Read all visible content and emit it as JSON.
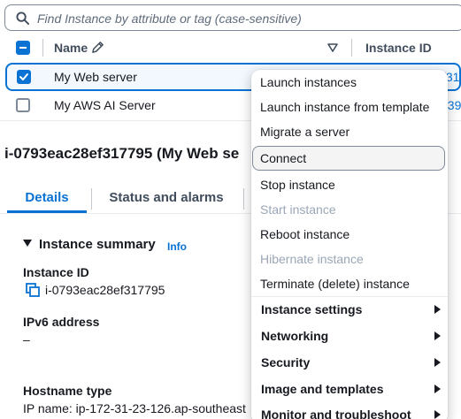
{
  "search": {
    "placeholder": "Find Instance by attribute or tag (case-sensitive)"
  },
  "table": {
    "headers": {
      "name": "Name",
      "instance_id": "Instance ID"
    },
    "rows": [
      {
        "name": "My Web server",
        "id_fragment": "f31",
        "selected": true
      },
      {
        "name": "My AWS AI Server",
        "id_fragment": "a39",
        "selected": false
      }
    ]
  },
  "details": {
    "title": "i-0793eac28ef317795 (My Web se",
    "tabs": [
      "Details",
      "Status and alarms"
    ],
    "summary": {
      "heading": "Instance summary",
      "info": "Info",
      "instance_id_label": "Instance ID",
      "instance_id_value": "i-0793eac28ef317795",
      "ipv6_label": "IPv6 address",
      "ipv6_value": "–",
      "hostname_label": "Hostname type",
      "hostname_value": "IP name: ip-172-31-23-126.ap-southeast"
    }
  },
  "menu": {
    "items": [
      {
        "label": "Launch instances"
      },
      {
        "label": "Launch instance from template"
      },
      {
        "label": "Migrate a server"
      },
      {
        "label": "Connect",
        "highlighted": true
      },
      {
        "label": "Stop instance"
      },
      {
        "label": "Start instance",
        "disabled": true
      },
      {
        "label": "Reboot instance"
      },
      {
        "label": "Hibernate instance",
        "disabled": true
      },
      {
        "label": "Terminate (delete) instance"
      },
      {
        "label": "Instance settings",
        "submenu": true
      },
      {
        "label": "Networking",
        "submenu": true
      },
      {
        "label": "Security",
        "submenu": true
      },
      {
        "label": "Image and templates",
        "submenu": true
      },
      {
        "label": "Monitor and troubleshoot",
        "submenu": true
      }
    ]
  },
  "colors": {
    "accent": "#0972d3",
    "text": "#16191f",
    "disabled": "#9ba7b6"
  }
}
